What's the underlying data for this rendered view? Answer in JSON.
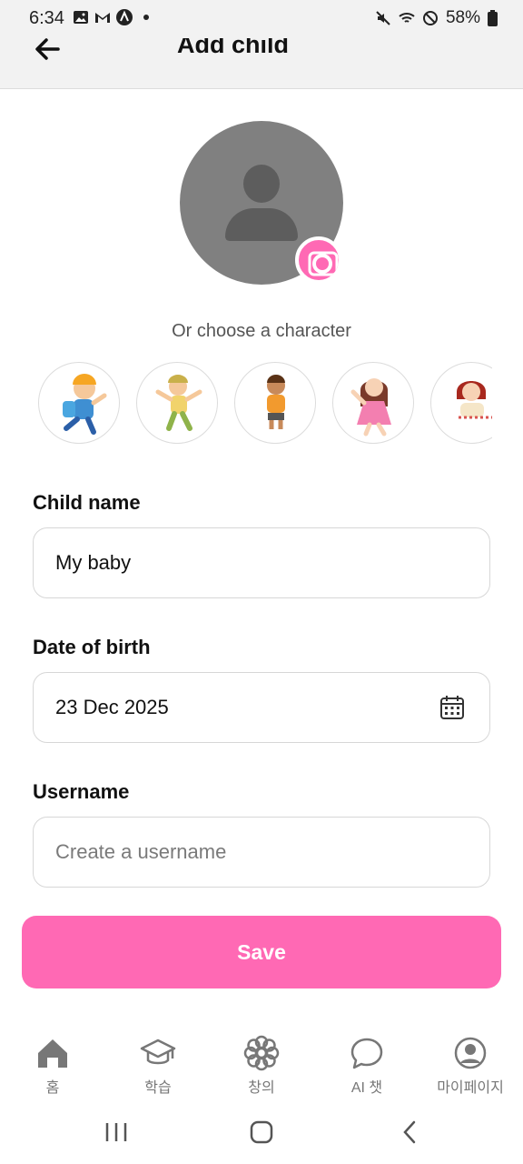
{
  "status_bar": {
    "time": "6:34",
    "battery": "58%"
  },
  "header": {
    "title": "Add child"
  },
  "avatar": {
    "choose_label": "Or choose a character"
  },
  "characters": [
    "boy-blue-cap",
    "boy-yellow-hat",
    "boy-orange-shirt",
    "girl-pink-dress",
    "girl-red-hair"
  ],
  "form": {
    "child_name": {
      "label": "Child name",
      "value": "My baby"
    },
    "date_of_birth": {
      "label": "Date of birth",
      "value": "23 Dec 2025"
    },
    "username": {
      "label": "Username",
      "placeholder": "Create a username",
      "value": ""
    },
    "save_label": "Save"
  },
  "bottom_nav": [
    {
      "label": "홈",
      "icon": "home-icon"
    },
    {
      "label": "학습",
      "icon": "graduation-cap-icon"
    },
    {
      "label": "창의",
      "icon": "flower-icon"
    },
    {
      "label": "AI 챗",
      "icon": "chat-bubble-icon"
    },
    {
      "label": "마이페이지",
      "icon": "profile-icon"
    }
  ],
  "colors": {
    "accent": "#ff69b4",
    "avatar_bg": "#808080",
    "header_bg": "#f2f2f2"
  }
}
